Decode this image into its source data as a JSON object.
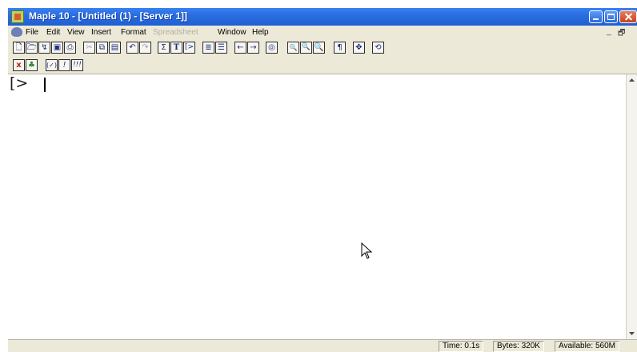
{
  "window": {
    "title": "Maple 10 - [Untitled (1) - [Server 1]]"
  },
  "menu": {
    "items": [
      {
        "label": "File",
        "enabled": true
      },
      {
        "label": "Edit",
        "enabled": true
      },
      {
        "label": "View",
        "enabled": true
      },
      {
        "label": "Insert",
        "enabled": true
      },
      {
        "label": "Format",
        "enabled": true
      },
      {
        "label": "Spreadsheet",
        "enabled": false
      },
      {
        "label": "Window",
        "enabled": true
      },
      {
        "label": "Help",
        "enabled": true
      }
    ],
    "mdi_minimize": "_",
    "mdi_restore": "🗗"
  },
  "toolbar": {
    "icons": [
      "new-icon",
      "open-icon",
      "open-url-icon",
      "save-icon",
      "print-icon",
      "cut-icon",
      "copy-icon",
      "paste-icon",
      "undo-icon",
      "redo-icon",
      "sum-icon",
      "text-icon",
      "input-icon",
      "indent-icon",
      "outdent-icon",
      "back-icon",
      "forward-icon",
      "stop-icon",
      "zoom-100-icon",
      "zoom-200-icon",
      "zoom-400-icon",
      "show-marks-icon",
      "fullscreen-icon",
      "restart-icon"
    ],
    "sum_glyph": "Σ",
    "text_glyph": "T",
    "input_glyph": "[>",
    "pilcrow_glyph": "¶"
  },
  "toolbar2": {
    "execute_selection_glyph": "x",
    "execute_all_glyph": "♣",
    "check_glyph": "(✓)",
    "exec_glyph": "!",
    "exec_all_glyph": "!!!"
  },
  "document": {
    "prompt": "[>"
  },
  "status": {
    "time": "Time: 0.1s",
    "bytes": "Bytes: 320K",
    "available": "Available: 560M"
  },
  "colors": {
    "titlebar": "#2a6ee0",
    "chrome": "#ece9d8"
  }
}
